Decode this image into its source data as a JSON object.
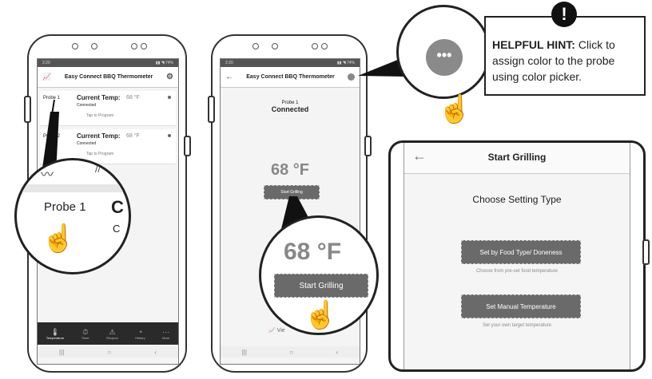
{
  "app": {
    "title": "Easy Connect BBQ Thermometer",
    "status_time": "2:20",
    "status_right": "▮▮ ◥ 74%"
  },
  "phone1": {
    "probe1": {
      "name": "Probe 1",
      "temp_label": "Current Temp:",
      "temp_value": "68 °F",
      "status": "Connected",
      "program": "Tap to Program"
    },
    "probe2": {
      "name": "Probe 2",
      "temp_label": "Current Temp:",
      "temp_value": "68 °F",
      "status": "Connected",
      "program": "Tap to Program"
    },
    "zoom": {
      "probe_name": "Probe 1",
      "letter": "C",
      "letter2": "C"
    },
    "tabs": [
      {
        "icon": "thermometer-icon",
        "glyph": "🌡",
        "label": "Temperature"
      },
      {
        "icon": "timer-icon",
        "glyph": "⏱",
        "label": "Timer"
      },
      {
        "icon": "recipes-icon",
        "glyph": "⚠",
        "label": "Recipes"
      },
      {
        "icon": "history-icon",
        "glyph": "◔",
        "label": "History"
      },
      {
        "icon": "more-icon",
        "glyph": "⋯",
        "label": "More"
      }
    ]
  },
  "phone2": {
    "probe_name": "Probe 1",
    "status": "Connected",
    "temp": "68 °F",
    "start_button": "Start Grilling",
    "zoom_temp": "68 °F",
    "zoom_button": "Start Grilling",
    "footer_label": "Vie"
  },
  "hint": {
    "bold": "HELPFUL HINT:",
    "text": "Click to assign color to the probe using color picker."
  },
  "panel": {
    "title": "Start Grilling",
    "heading": "Choose Setting Type",
    "option1_label": "Set by Food Type/ Doneness",
    "option1_desc": "Choose from pre-set food temperature",
    "option2_label": "Set Manual Temperature",
    "option2_desc": "Set your own target temperature"
  },
  "nav": {
    "back": "‹",
    "home": "○",
    "recents": "|||"
  },
  "colors": {
    "accent_gray": "#6a6a6a",
    "dark": "#2a2a2a"
  }
}
